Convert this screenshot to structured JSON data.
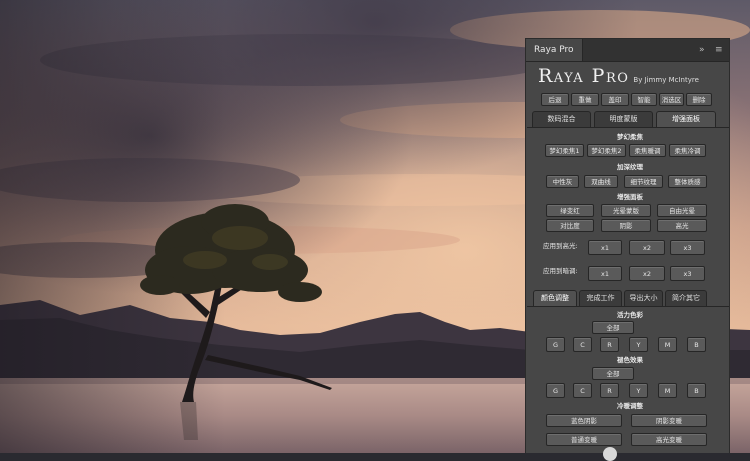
{
  "panel": {
    "tab_title": "Raya Pro",
    "expand_glyph": "»",
    "menu_glyph": "≡",
    "brand": "Raya Pro",
    "brand_sub": "By Jimmy McIntyre",
    "actions": [
      "后退",
      "重做",
      "盖印",
      "智能",
      "消选区",
      "删除"
    ],
    "main_tabs": [
      "数码混合",
      "明度蒙版",
      "增强面板"
    ],
    "main_tab_active": 2,
    "dreamy_title": "梦幻柔焦",
    "dreamy_buttons": [
      "梦幻柔焦1",
      "梦幻柔焦2",
      "柔焦暖调",
      "柔焦冷调"
    ],
    "texture_title": "加深纹理",
    "texture_buttons": [
      "中性灰",
      "双曲线",
      "细节纹理",
      "整体质感"
    ],
    "enhance_title": "增强面板",
    "enhance_row1": [
      "绿变红",
      "光晕蒙版",
      "自由光晕"
    ],
    "enhance_row2": [
      "对比度",
      "阴影",
      "高光"
    ],
    "apply_highlights": "应用到高光:",
    "apply_shadows": "应用到暗调:",
    "multipliers": [
      "x1",
      "x2",
      "x3"
    ],
    "lower_tabs": [
      "颜色调整",
      "完成工作",
      "导出大小",
      "简介其它"
    ],
    "lower_tab_active": 0,
    "vibrance_title": "活力色彩",
    "saturation_title": "褪色效果",
    "warmcool_title": "冷暖调整",
    "all_label": "全部",
    "channels": [
      "G",
      "C",
      "R",
      "Y",
      "M",
      "B"
    ],
    "warmcool_row1": [
      "蓝色阴影",
      "阴影变暖"
    ],
    "warmcool_row2": [
      "普通变暖",
      "高光变暖"
    ]
  },
  "colors": {
    "panel_bg": "#474747",
    "titlebar_bg": "#323232",
    "button_bg": "#5a5a5a",
    "active_tab": "#515151"
  }
}
